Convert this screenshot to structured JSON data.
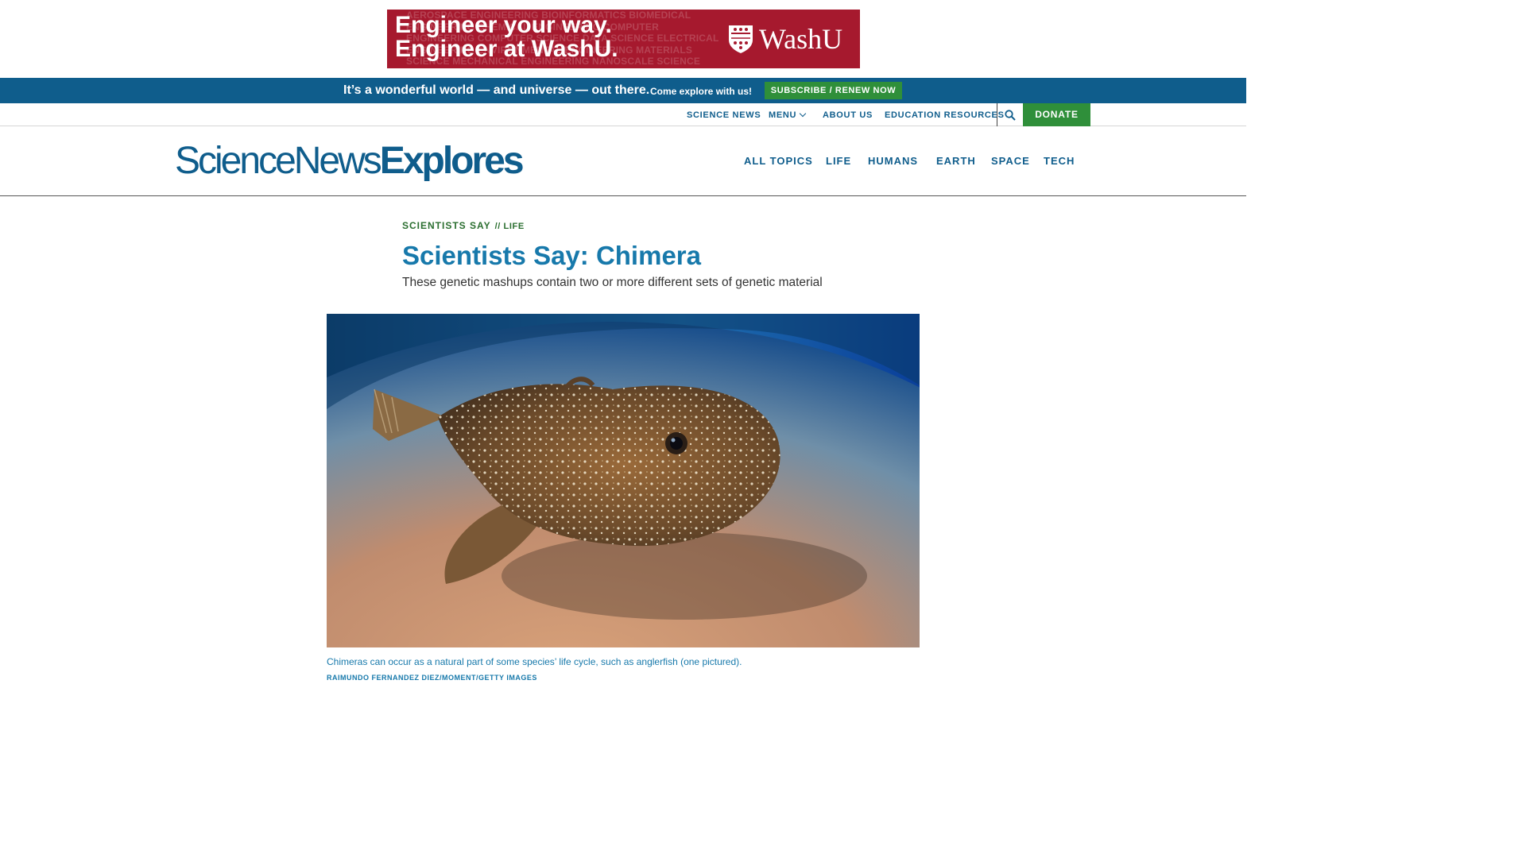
{
  "ad": {
    "headline_line1": "Engineer your way.",
    "headline_line2": "Engineer at WashU.",
    "brand": "WashU",
    "background_text": "AEROSPACE ENGINEERING BIOINFORMATICS BIOMEDICAL ENGINEERING CHEMICAL ENGINEERING COMPUTER ENGINEERING COMPUTER SCIENCE DATA SCIENCE ELECTRICAL ENGINEERING ENVIRONMENTAL ENGINEERING MATERIALS SCIENCE MECHANICAL ENGINEERING NANOSCALE SCIENCE ROBOTICS SYSTEMS SCIENCE ENGINEERING",
    "color": "#a6192e"
  },
  "subscribe_bar": {
    "tagline": "It’s a wonderful world — and universe — out there.",
    "cta_text": "Come explore with us!",
    "button_label": "Subscribe / Renew Now"
  },
  "utility_nav": {
    "links": [
      "Science News",
      "Menu",
      "About Us",
      "Education Resources"
    ],
    "donate_label": "Donate",
    "search_icon": "search-icon"
  },
  "header": {
    "logo_part1": "ScienceNews",
    "logo_part2": "Explores",
    "topics": [
      "All Topics",
      "Life",
      "Humans",
      "Earth",
      "Space",
      "Tech"
    ]
  },
  "article": {
    "kicker": "Scientists Say",
    "kicker_section": "// Life",
    "title": "Scientists Say: Chimera",
    "dek": "These genetic mashups contain two or more different sets of genetic material",
    "image_caption": "Chimeras can occur as a natural part of some species’ life cycle, such as anglerfish (one pictured).",
    "image_credit": "Raimundo Fernandez Diez/Moment/Getty Images"
  },
  "colors": {
    "brand_blue": "#0f5d8c",
    "headline_blue": "#1779ab",
    "green": "#2f8f3a",
    "kicker_green": "#2a6e2f"
  }
}
